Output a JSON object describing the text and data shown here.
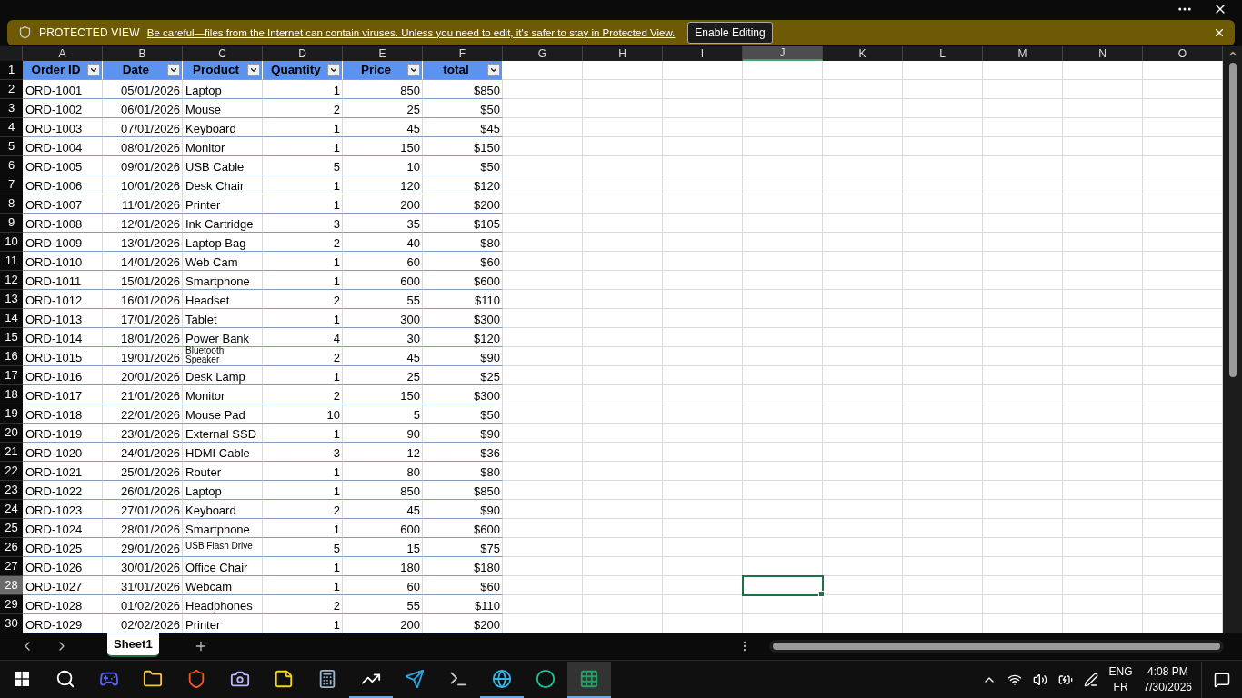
{
  "protected_view": {
    "label": "PROTECTED VIEW",
    "message": "Be careful—files from the Internet can contain viruses. Unless you need to edit, it's safer to stay in Protected View.",
    "button": "Enable Editing"
  },
  "sheet": {
    "columns": [
      {
        "label": "A",
        "selected": false
      },
      {
        "label": "B",
        "selected": false
      },
      {
        "label": "C",
        "selected": false
      },
      {
        "label": "D",
        "selected": false
      },
      {
        "label": "E",
        "selected": false
      },
      {
        "label": "F",
        "selected": false
      },
      {
        "label": "G",
        "selected": false
      },
      {
        "label": "H",
        "selected": false
      },
      {
        "label": "I",
        "selected": false
      },
      {
        "label": "J",
        "selected": true
      },
      {
        "label": "K",
        "selected": false
      },
      {
        "label": "L",
        "selected": false
      },
      {
        "label": "M",
        "selected": false
      },
      {
        "label": "N",
        "selected": false
      },
      {
        "label": "O",
        "selected": false
      }
    ],
    "table_header": {
      "number": "1",
      "cells": [
        "Order ID",
        "Date",
        "Product",
        "Quantity",
        "Price",
        "total"
      ]
    },
    "rows": [
      {
        "number": "2",
        "selected": false,
        "wrapped": false,
        "cells": [
          "ORD-1001",
          "05/01/2026",
          "Laptop",
          "1",
          "850",
          "$850"
        ]
      },
      {
        "number": "3",
        "selected": false,
        "wrapped": false,
        "cells": [
          "ORD-1002",
          "06/01/2026",
          "Mouse",
          "2",
          "25",
          "$50"
        ]
      },
      {
        "number": "4",
        "selected": false,
        "wrapped": false,
        "cells": [
          "ORD-1003",
          "07/01/2026",
          "Keyboard",
          "1",
          "45",
          "$45"
        ]
      },
      {
        "number": "5",
        "selected": false,
        "wrapped": false,
        "cells": [
          "ORD-1004",
          "08/01/2026",
          "Monitor",
          "1",
          "150",
          "$150"
        ]
      },
      {
        "number": "6",
        "selected": false,
        "wrapped": false,
        "cells": [
          "ORD-1005",
          "09/01/2026",
          "USB Cable",
          "5",
          "10",
          "$50"
        ]
      },
      {
        "number": "7",
        "selected": false,
        "wrapped": false,
        "cells": [
          "ORD-1006",
          "10/01/2026",
          "Desk Chair",
          "1",
          "120",
          "$120"
        ]
      },
      {
        "number": "8",
        "selected": false,
        "wrapped": false,
        "cells": [
          "ORD-1007",
          "11/01/2026",
          "Printer",
          "1",
          "200",
          "$200"
        ]
      },
      {
        "number": "9",
        "selected": false,
        "wrapped": false,
        "cells": [
          "ORD-1008",
          "12/01/2026",
          "Ink Cartridge",
          "3",
          "35",
          "$105"
        ]
      },
      {
        "number": "10",
        "selected": false,
        "wrapped": false,
        "cells": [
          "ORD-1009",
          "13/01/2026",
          "Laptop Bag",
          "2",
          "40",
          "$80"
        ]
      },
      {
        "number": "11",
        "selected": false,
        "wrapped": false,
        "cells": [
          "ORD-1010",
          "14/01/2026",
          "Web Cam",
          "1",
          "60",
          "$60"
        ]
      },
      {
        "number": "12",
        "selected": false,
        "wrapped": false,
        "cells": [
          "ORD-1011",
          "15/01/2026",
          "Smartphone",
          "1",
          "600",
          "$600"
        ]
      },
      {
        "number": "13",
        "selected": false,
        "wrapped": false,
        "cells": [
          "ORD-1012",
          "16/01/2026",
          "Headset",
          "2",
          "55",
          "$110"
        ]
      },
      {
        "number": "14",
        "selected": false,
        "wrapped": false,
        "cells": [
          "ORD-1013",
          "17/01/2026",
          "Tablet",
          "1",
          "300",
          "$300"
        ]
      },
      {
        "number": "15",
        "selected": false,
        "wrapped": false,
        "cells": [
          "ORD-1014",
          "18/01/2026",
          "Power Bank",
          "4",
          "30",
          "$120"
        ]
      },
      {
        "number": "16",
        "selected": false,
        "wrapped": true,
        "cells": [
          "ORD-1015",
          "19/01/2026",
          "Bluetooth Speaker",
          "2",
          "45",
          "$90"
        ]
      },
      {
        "number": "17",
        "selected": false,
        "wrapped": false,
        "cells": [
          "ORD-1016",
          "20/01/2026",
          "Desk Lamp",
          "1",
          "25",
          "$25"
        ]
      },
      {
        "number": "18",
        "selected": false,
        "wrapped": false,
        "cells": [
          "ORD-1017",
          "21/01/2026",
          "Monitor",
          "2",
          "150",
          "$300"
        ]
      },
      {
        "number": "19",
        "selected": false,
        "wrapped": false,
        "cells": [
          "ORD-1018",
          "22/01/2026",
          "Mouse Pad",
          "10",
          "5",
          "$50"
        ]
      },
      {
        "number": "20",
        "selected": false,
        "wrapped": false,
        "cells": [
          "ORD-1019",
          "23/01/2026",
          "External SSD",
          "1",
          "90",
          "$90"
        ]
      },
      {
        "number": "21",
        "selected": false,
        "wrapped": false,
        "cells": [
          "ORD-1020",
          "24/01/2026",
          "HDMI Cable",
          "3",
          "12",
          "$36"
        ]
      },
      {
        "number": "22",
        "selected": false,
        "wrapped": false,
        "cells": [
          "ORD-1021",
          "25/01/2026",
          "Router",
          "1",
          "80",
          "$80"
        ]
      },
      {
        "number": "23",
        "selected": false,
        "wrapped": false,
        "cells": [
          "ORD-1022",
          "26/01/2026",
          "Laptop",
          "1",
          "850",
          "$850"
        ]
      },
      {
        "number": "24",
        "selected": false,
        "wrapped": false,
        "cells": [
          "ORD-1023",
          "27/01/2026",
          "Keyboard",
          "2",
          "45",
          "$90"
        ]
      },
      {
        "number": "25",
        "selected": false,
        "wrapped": false,
        "cells": [
          "ORD-1024",
          "28/01/2026",
          "Smartphone",
          "1",
          "600",
          "$600"
        ]
      },
      {
        "number": "26",
        "selected": false,
        "wrapped": true,
        "cells": [
          "ORD-1025",
          "29/01/2026",
          "USB Flash Drive",
          "5",
          "15",
          "$75"
        ]
      },
      {
        "number": "27",
        "selected": false,
        "wrapped": false,
        "cells": [
          "ORD-1026",
          "30/01/2026",
          "Office Chair",
          "1",
          "180",
          "$180"
        ]
      },
      {
        "number": "28",
        "selected": true,
        "wrapped": false,
        "cells": [
          "ORD-1027",
          "31/01/2026",
          "Webcam",
          "1",
          "60",
          "$60"
        ]
      },
      {
        "number": "29",
        "selected": false,
        "wrapped": false,
        "cells": [
          "ORD-1028",
          "01/02/2026",
          "Headphones",
          "2",
          "55",
          "$110"
        ]
      },
      {
        "number": "30",
        "selected": false,
        "wrapped": false,
        "cells": [
          "ORD-1029",
          "02/02/2026",
          "Printer",
          "1",
          "200",
          "$200"
        ]
      }
    ]
  },
  "sheet_tabs": [
    {
      "label": "Sheet1",
      "selected": true
    }
  ],
  "taskbar": {
    "apps": [
      {
        "kind": "chat",
        "running": false,
        "active": false
      },
      {
        "kind": "folder",
        "running": false,
        "active": false
      },
      {
        "kind": "shield",
        "running": false,
        "active": false
      },
      {
        "kind": "camera",
        "running": false,
        "active": false
      },
      {
        "kind": "note",
        "running": false,
        "active": false
      },
      {
        "kind": "calculator",
        "running": false,
        "active": false
      },
      {
        "kind": "chart",
        "running": true,
        "active": false
      },
      {
        "kind": "send",
        "running": false,
        "active": false
      },
      {
        "kind": "terminal",
        "running": false,
        "active": false
      },
      {
        "kind": "browser",
        "running": true,
        "active": false
      },
      {
        "kind": "circle",
        "running": false,
        "active": false
      },
      {
        "kind": "spreadsheet",
        "running": true,
        "active": true
      }
    ],
    "language": "ENG",
    "keyboard": "FR",
    "time": "4:08 PM",
    "date": "7/30/2026"
  }
}
